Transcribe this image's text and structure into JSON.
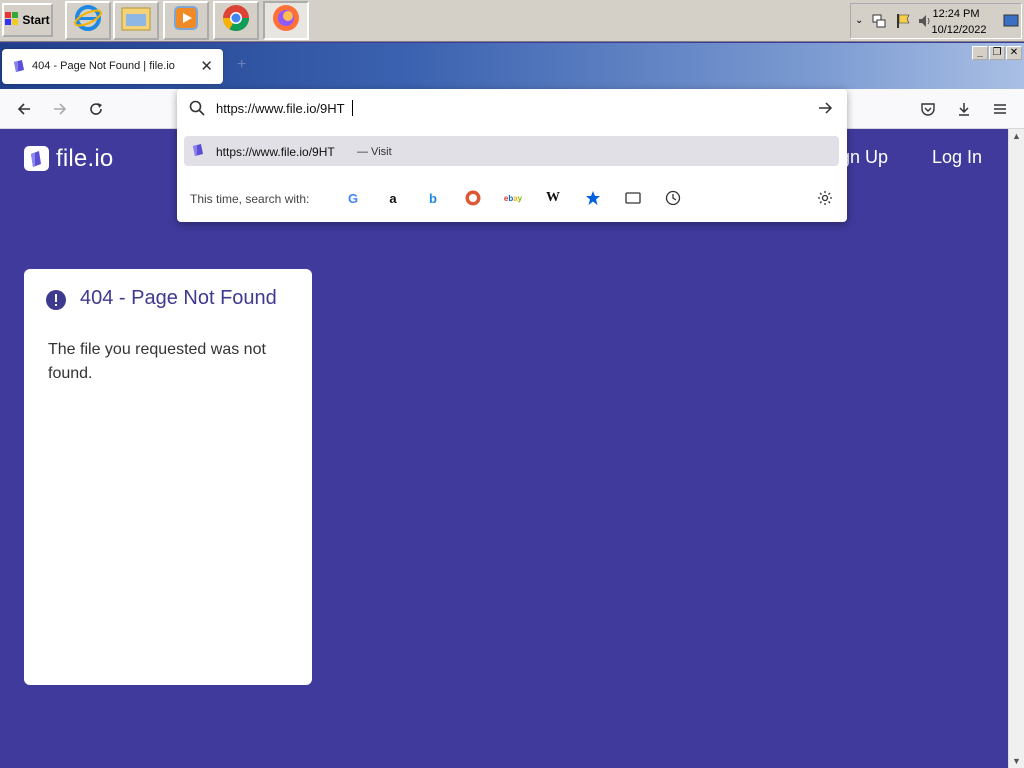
{
  "taskbar": {
    "start_label": "Start",
    "clock_time": "12:24 PM",
    "clock_date": "10/12/2022"
  },
  "browser": {
    "tab_title": "404 - Page Not Found | file.io",
    "url_input": "https://www.file.io/9HT",
    "suggestion_url": "https://www.file.io/9HT",
    "suggestion_action": "— Visit",
    "search_with_label": "This time, search with:"
  },
  "page": {
    "logo_text": "file.io",
    "nav_sign_up": "ign Up",
    "nav_log_in": "Log In",
    "error_title": "404 - Page Not Found",
    "error_message": "The file you requested was not found."
  },
  "colors": {
    "page_bg": "#3f3a9b",
    "accent_text": "#3d3a8f"
  }
}
